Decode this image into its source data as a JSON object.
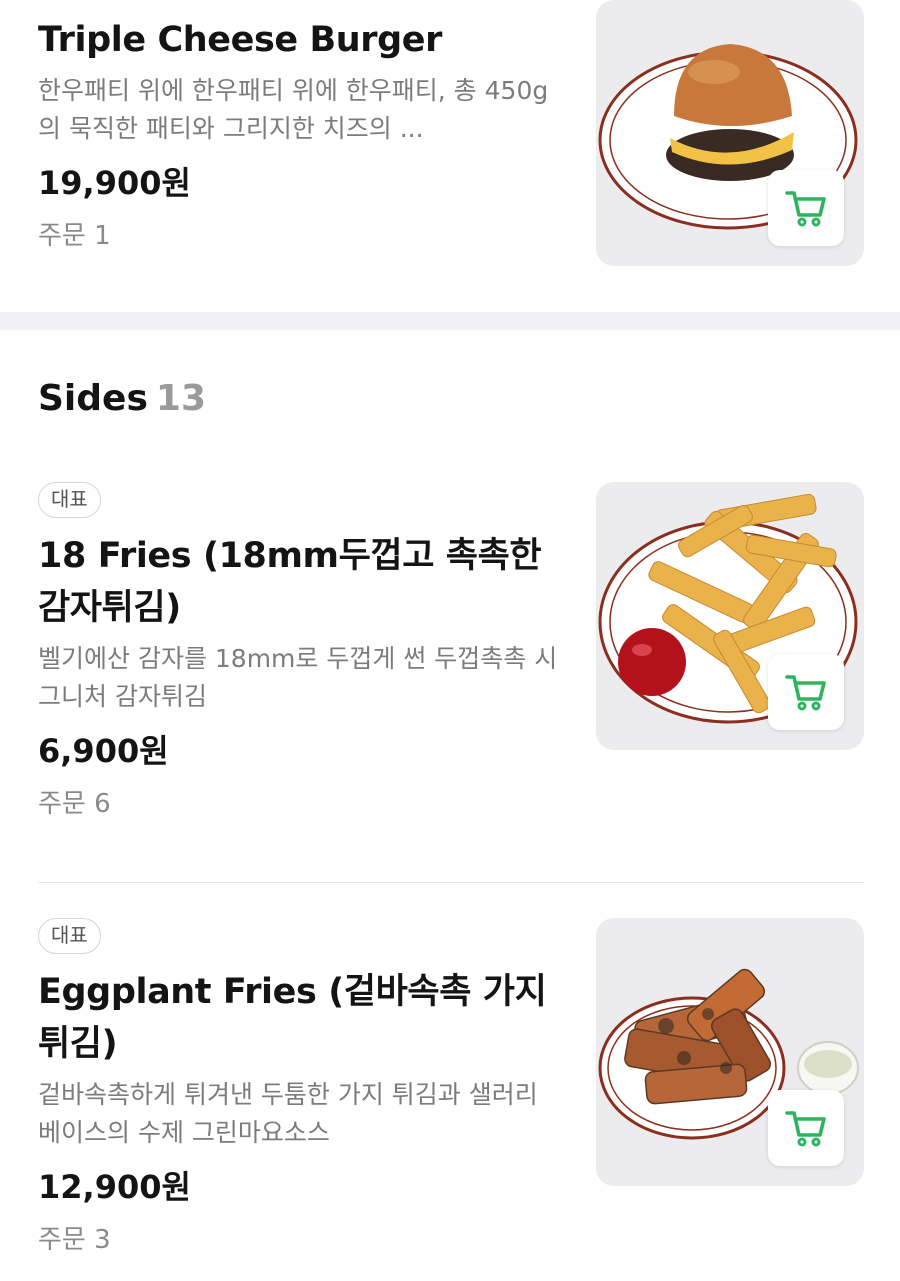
{
  "items_top": {
    "name": "Triple Cheese Burger",
    "description": "한우패티 위에 한우패티 위에 한우패티, 총 450g의 묵직한 패티와 그리지한 치즈의 ...",
    "price": "19,900원",
    "orders": "주문 1"
  },
  "sides": {
    "title": "Sides",
    "count": "13",
    "items": [
      {
        "badge": "대표",
        "name": "18 Fries (18mm두껍고 촉촉한 감자튀김)",
        "description": "벨기에산 감자를 18mm로 두껍게 썬 두껍촉촉 시그니처 감자튀김",
        "price": "6,900원",
        "orders": "주문 6"
      },
      {
        "badge": "대표",
        "name": "Eggplant Fries (겉바속촉 가지 튀김)",
        "description": "겉바속촉하게 튀겨낸 두툼한 가지 튀김과 샐러리 베이스의 수제 그린마요소스",
        "price": "12,900원",
        "orders": "주문 3"
      }
    ]
  },
  "colors": {
    "cart_icon": "#2db55d",
    "section_gap": "#f1f1f3",
    "thumb_bg": "#ececee"
  },
  "icons": {
    "cart": "cart-icon"
  }
}
